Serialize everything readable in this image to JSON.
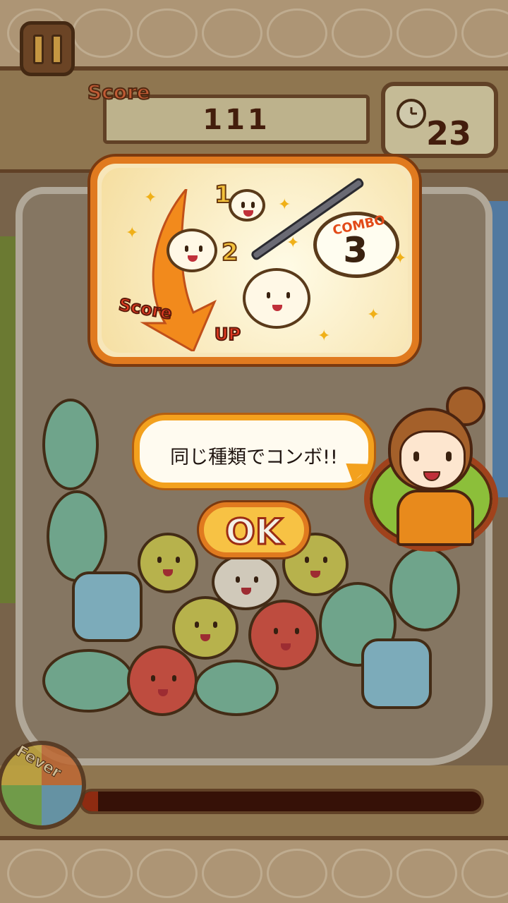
{
  "hud": {
    "score_label": "Score",
    "score_value": "111",
    "timer_value": "23",
    "pause_label": "pause"
  },
  "tutorial": {
    "numbers": [
      "1",
      "2"
    ],
    "combo_word": "COMBO",
    "combo_count": "3",
    "score_word": "Score",
    "up_word": "UP"
  },
  "dialog": {
    "message": "同じ種類でコンボ!!",
    "ok_label": "OK"
  },
  "fever": {
    "label": "Fever",
    "progress": 0.04
  },
  "colors": {
    "accent": "#e07a1f",
    "fever_fill": "#a52f12"
  }
}
